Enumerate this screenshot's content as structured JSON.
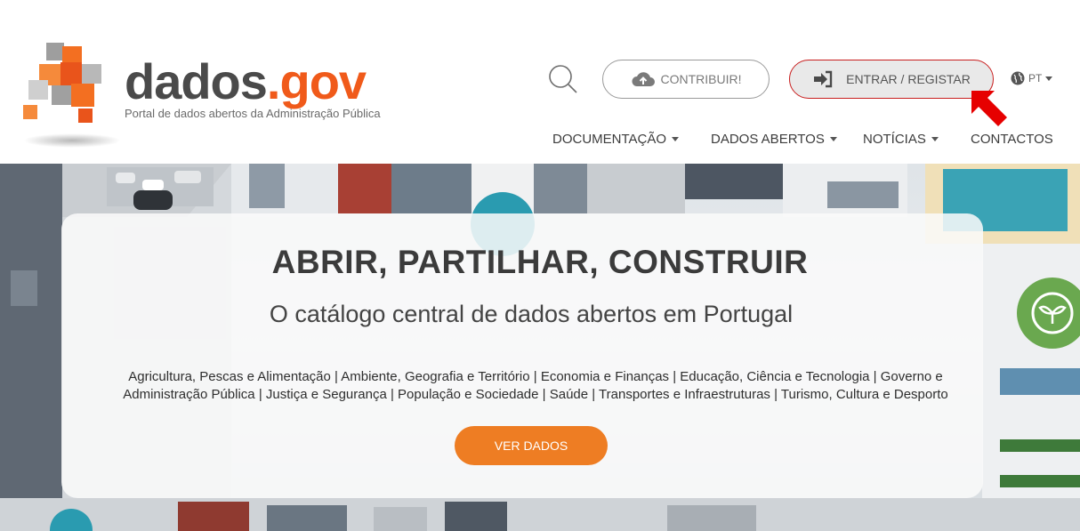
{
  "header": {
    "logo": {
      "word_part1": "dados",
      "word_part2": ".gov",
      "tagline": "Portal de dados abertos da Administração Pública"
    },
    "search_icon": "search-icon",
    "contribute": {
      "label": "CONTRIBUIR!",
      "icon": "cloud-upload-icon"
    },
    "login": {
      "label": "ENTRAR / REGISTAR",
      "icon": "sign-in-icon"
    },
    "language": {
      "label": "PT",
      "icon": "globe-icon"
    },
    "nav": [
      {
        "label": "DOCUMENTAÇÃO"
      },
      {
        "label": "DADOS ABERTOS"
      },
      {
        "label": "NOTÍCIAS"
      },
      {
        "label": "CONTACTOS"
      }
    ]
  },
  "hero": {
    "title": "ABRIR, PARTILHAR, CONSTRUIR",
    "subtitle": "O catálogo central de dados abertos em Portugal",
    "categories_line1": "Agricultura, Pescas e Alimentação | Ambiente, Geografia e Território | Economia e Finanças | Educação, Ciência e Tecnologia | Governo e",
    "categories_line2": "Administração Pública | Justiça e Segurança | População e Sociedade | Saúde | Transportes e Infraestruturas | Turismo, Cultura e Desporto",
    "cta": "VER DADOS"
  },
  "colors": {
    "brand_orange": "#f05a1a",
    "cta_orange": "#ee7d23",
    "login_border": "#c81e1e",
    "annotation_arrow": "#e60000",
    "badge_green": "#6aa84f",
    "teal": "#2a9bb0"
  }
}
